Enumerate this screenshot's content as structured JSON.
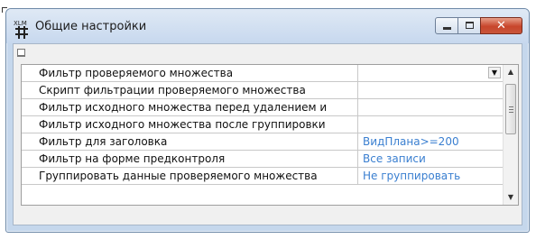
{
  "window": {
    "title": "Общие настройки",
    "app_icon_text": "XLM"
  },
  "caption_buttons": {
    "minimize": "minimize",
    "maximize": "maximize",
    "close": "✕"
  },
  "grid": {
    "rows": [
      {
        "name": "Фильтр проверяемого множества",
        "value": "",
        "has_dropdown": true
      },
      {
        "name": "Скрипт фильтрации проверяемого множества",
        "value": ""
      },
      {
        "name": "Фильтр исходного множества перед удалением и",
        "value": ""
      },
      {
        "name": "Фильтр исходного множества после группировки",
        "value": ""
      },
      {
        "name": "Фильтр для заголовка",
        "value": "ВидПлана>=200"
      },
      {
        "name": "Фильтр на форме предконтроля",
        "value": "Все записи"
      },
      {
        "name": "Группировать данные проверяемого множества",
        "value": "Не группировать"
      }
    ]
  },
  "scrollbar": {
    "up": "▲",
    "down": "▼"
  },
  "colors": {
    "value_text": "#3a7fd0",
    "close_button": "#c8452b"
  }
}
